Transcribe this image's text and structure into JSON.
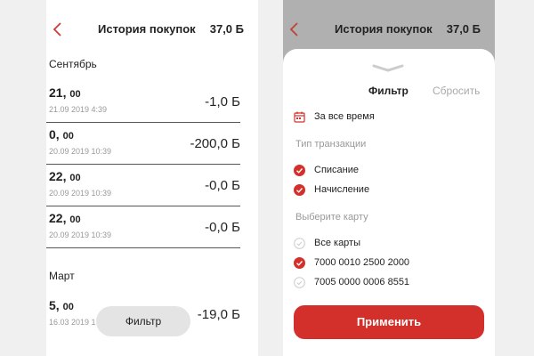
{
  "left_screen": {
    "header": {
      "title": "История покупок",
      "balance": "37,0 Б"
    },
    "groups": [
      {
        "month": "Сентябрь",
        "transactions": [
          {
            "amount_int": "21,",
            "amount_dec": "00",
            "date": "21.09 2019 4:39",
            "value": "-1,0 Б"
          },
          {
            "amount_int": "0,",
            "amount_dec": "00",
            "date": "20.09 2019 10:39",
            "value": "-200,0 Б"
          },
          {
            "amount_int": "22,",
            "amount_dec": "00",
            "date": "20.09 2019 10:39",
            "value": "-0,0 Б"
          },
          {
            "amount_int": "22,",
            "amount_dec": "00",
            "date": "20.09 2019 10:39",
            "value": "-0,0 Б"
          }
        ]
      },
      {
        "month": "Март",
        "transactions": [
          {
            "amount_int": "5,",
            "amount_dec": "00",
            "date": "16.03 2019 1",
            "value": "-19,0 Б"
          }
        ]
      }
    ],
    "filter_button": "Фильтр"
  },
  "right_screen": {
    "header": {
      "title": "История покупок",
      "balance": "37,0 Б"
    },
    "sheet": {
      "tab_filter": "Фильтр",
      "tab_reset": "Сбросить",
      "period": "За все время",
      "section_type": "Тип транзакции",
      "types": [
        {
          "label": "Списание",
          "checked": true
        },
        {
          "label": "Начисление",
          "checked": true
        }
      ],
      "section_card": "Выберите карту",
      "cards": [
        {
          "label": "Все карты",
          "checked": false
        },
        {
          "label": "7000 0010 2500 2000",
          "checked": true
        },
        {
          "label": "7005 0000 0006 8551",
          "checked": false
        }
      ],
      "apply_button": "Применить"
    }
  },
  "colors": {
    "accent": "#d3302b",
    "muted": "#999999",
    "overlay": "#b0b0b0"
  },
  "icons": {
    "back": "chevron-left-icon",
    "calendar": "calendar-icon",
    "checked": "checked-circle-icon",
    "unchecked": "unchecked-circle-icon"
  }
}
